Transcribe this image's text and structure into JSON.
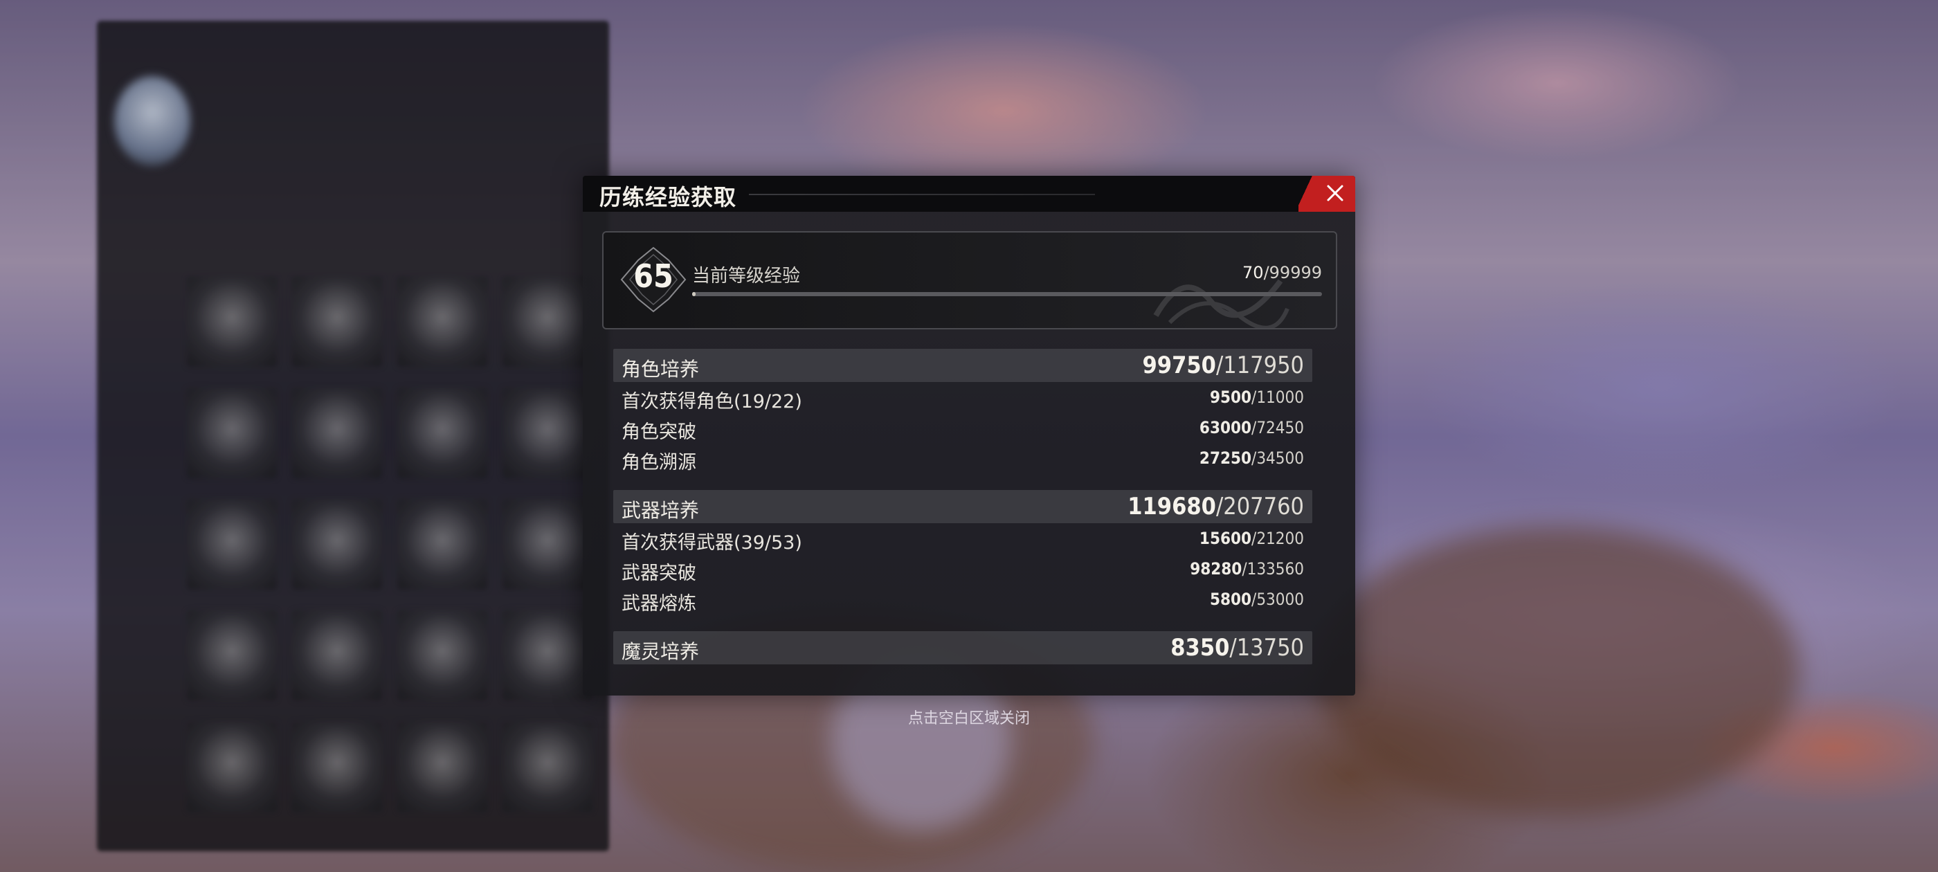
{
  "dialog": {
    "title": "历练经验获取",
    "close_icon": "close-icon",
    "accent_color": "#c21f1f"
  },
  "level": {
    "number": "65",
    "label": "当前等级经验",
    "current": "70",
    "max": "/99999",
    "progress": 0.0007
  },
  "sections": [
    {
      "label": "角色培养",
      "current": "99750",
      "max": "/117950",
      "rows": [
        {
          "label": "首次获得角色(19/22)",
          "current": "9500",
          "max": "/11000"
        },
        {
          "label": "角色突破",
          "current": "63000",
          "max": "/72450"
        },
        {
          "label": "角色溯源",
          "current": "27250",
          "max": "/34500"
        }
      ]
    },
    {
      "label": "武器培养",
      "current": "119680",
      "max": "/207760",
      "rows": [
        {
          "label": "首次获得武器(39/53)",
          "current": "15600",
          "max": "/21200"
        },
        {
          "label": "武器突破",
          "current": "98280",
          "max": "/133560"
        },
        {
          "label": "武器熔炼",
          "current": "5800",
          "max": "/53000"
        }
      ]
    },
    {
      "label": "魔灵培养",
      "current": "8350",
      "max": "/13750",
      "rows": []
    }
  ],
  "hint": "点击空白区域关闭"
}
